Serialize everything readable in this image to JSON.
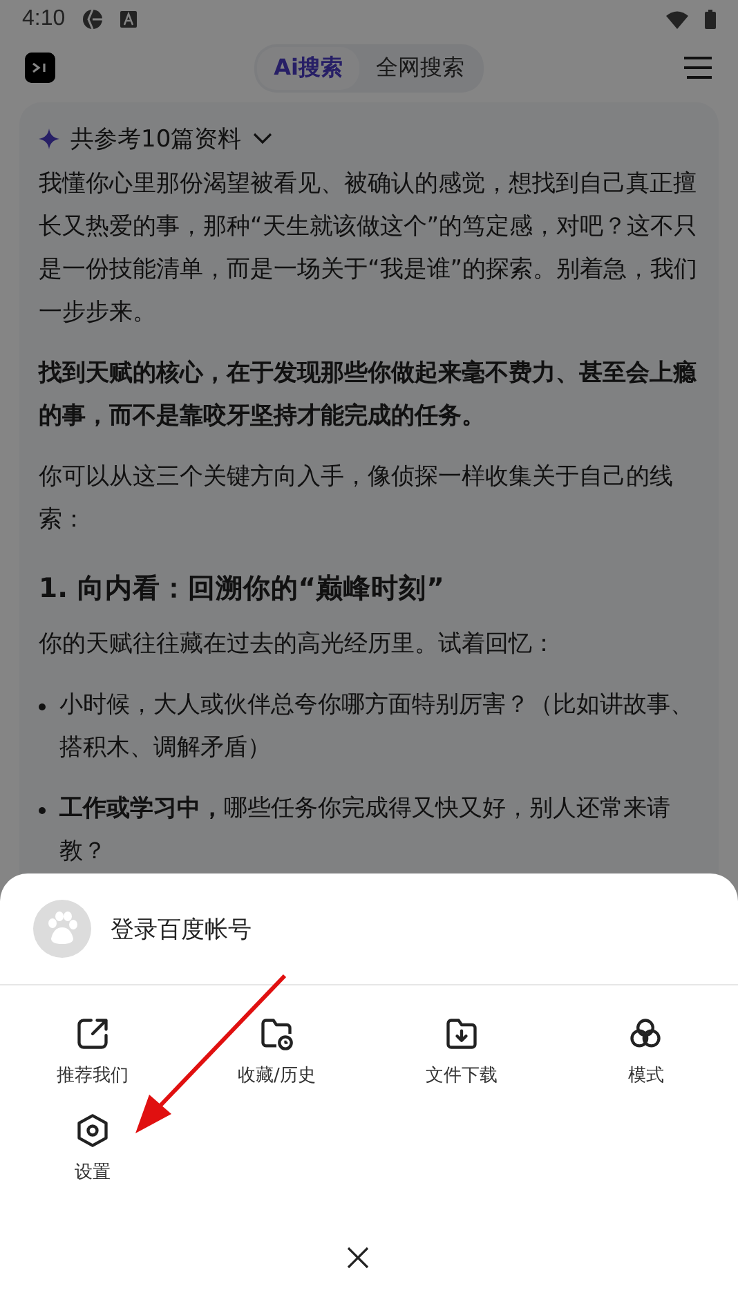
{
  "status_bar": {
    "time": "4:10"
  },
  "header": {
    "tabs": [
      {
        "label": "Ai搜索",
        "selected": true
      },
      {
        "label": "全网搜索",
        "selected": false
      }
    ]
  },
  "answer": {
    "sources": "共参考10篇资料",
    "blocks": [
      {
        "kind": "paragraph",
        "text": "我懂你心里那份渴望被看见、被确认的感觉，想找到自己真正擅长又热爱的事，那种“天生就该做这个”的笃定感，对吧？这不只是一份技能清单，而是一场关于“我是谁”的探索。别着急，我们一步步来。"
      },
      {
        "kind": "strong",
        "text": "找到天赋的核心，在于发现那些你做起来毫不费力、甚至会上瘾的事，而不是靠咬牙坚持才能完成的任务。"
      },
      {
        "kind": "paragraph",
        "text": "你可以从这三个关键方向入手，像侦探一样收集关于自己的线索："
      },
      {
        "kind": "heading",
        "text": "1. 向内看：回溯你的“巅峰时刻”"
      },
      {
        "kind": "paragraph",
        "text": "你的天赋往往藏在过去的高光经历里。试着回忆："
      },
      {
        "kind": "bullet",
        "text": "小时候，大人或伙伴总夸你哪方面特别厉害？（比如讲故事、搭积木、调解矛盾）"
      },
      {
        "kind": "bullet",
        "text": "**工作或学习中，**哪些任务你完成得又快又好，别人还常来请教？"
      }
    ]
  },
  "sheet": {
    "account": "登录百度帐号",
    "items": [
      {
        "kind": "share",
        "label": "推荐我们"
      },
      {
        "kind": "history",
        "label": "收藏/历史"
      },
      {
        "kind": "download",
        "label": "文件下载"
      },
      {
        "kind": "mode",
        "label": "模式"
      },
      {
        "kind": "settings",
        "label": "设置"
      }
    ]
  }
}
